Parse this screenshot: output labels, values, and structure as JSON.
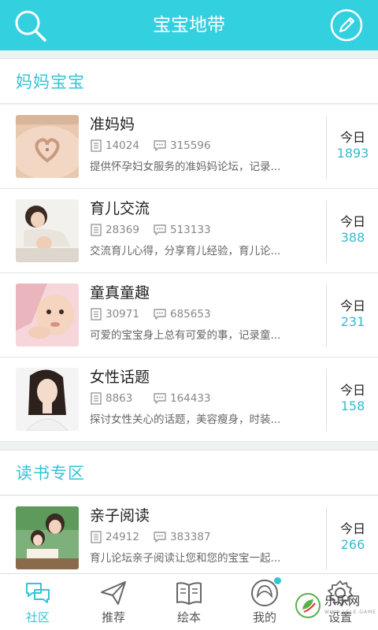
{
  "header": {
    "title": "宝宝地带",
    "search_icon": "search-icon",
    "edit_icon": "edit-icon",
    "accent_color": "#33d0e0"
  },
  "sections": [
    {
      "title": "妈妈宝宝",
      "forums": [
        {
          "title": "准妈妈",
          "topics": "14024",
          "replies": "315596",
          "desc": "提供怀孕妇女服务的准妈妈论坛，记录...",
          "today_label": "今日",
          "today_count": "1893"
        },
        {
          "title": "育儿交流",
          "topics": "28369",
          "replies": "513133",
          "desc": "交流育儿心得，分享育儿经验，育儿论...",
          "today_label": "今日",
          "today_count": "388"
        },
        {
          "title": "童真童趣",
          "topics": "30971",
          "replies": "685653",
          "desc": "可爱的宝宝身上总有可爱的事，记录童...",
          "today_label": "今日",
          "today_count": "231"
        },
        {
          "title": "女性话题",
          "topics": "8863",
          "replies": "164433",
          "desc": "探讨女性关心的话题，美容瘦身，时装...",
          "today_label": "今日",
          "today_count": "158"
        }
      ]
    },
    {
      "title": "读书专区",
      "forums": [
        {
          "title": "亲子阅读",
          "topics": "24912",
          "replies": "383387",
          "desc": "育儿论坛亲子阅读让您和您的宝宝一起...",
          "today_label": "今日",
          "today_count": "266"
        }
      ]
    }
  ],
  "tabbar": {
    "tabs": [
      {
        "label": "社区",
        "icon": "community-icon",
        "active": true
      },
      {
        "label": "推荐",
        "icon": "paper-plane-icon"
      },
      {
        "label": "绘本",
        "icon": "book-icon"
      },
      {
        "label": "我的",
        "icon": "profile-icon"
      },
      {
        "label": "设置",
        "icon": "gear-icon"
      }
    ]
  },
  "watermark": {
    "text": "乐乐网",
    "sub": "WWW.LELE.GAME"
  }
}
